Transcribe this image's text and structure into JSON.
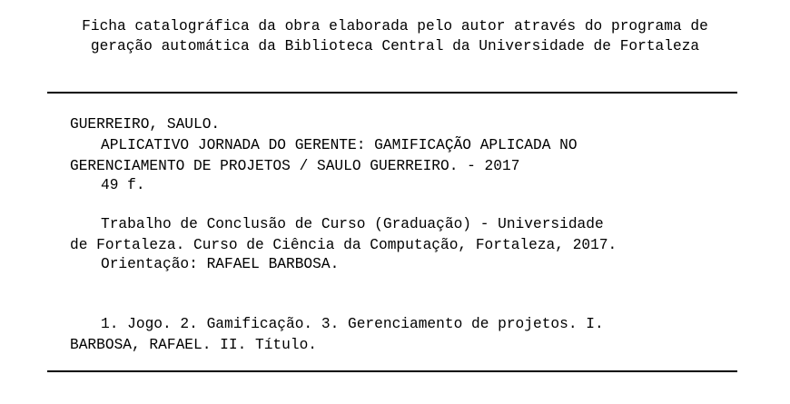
{
  "header": {
    "line1": "Ficha catalográfica da obra elaborada pelo autor através do programa de",
    "line2": "geração automática da Biblioteca Central da Universidade de Fortaleza"
  },
  "record": {
    "author": "GUERREIRO, SAULO.",
    "title_line1": "APLICATIVO JORNADA DO GERENTE: GAMIFICAÇÃO APLICADA NO",
    "title_line2": "GERENCIAMENTO DE PROJETOS / SAULO GUERREIRO. - 2017",
    "pages": "49 f.",
    "thesis_line1": "Trabalho de Conclusão de Curso (Graduação) - Universidade",
    "thesis_line2": "de Fortaleza. Curso de Ciência da Computação, Fortaleza, 2017.",
    "advisor": "Orientação: RAFAEL BARBOSA.",
    "subjects_line1": "1. Jogo. 2. Gamificação. 3. Gerenciamento de projetos. I.",
    "subjects_line2": "BARBOSA, RAFAEL. II. Título."
  }
}
